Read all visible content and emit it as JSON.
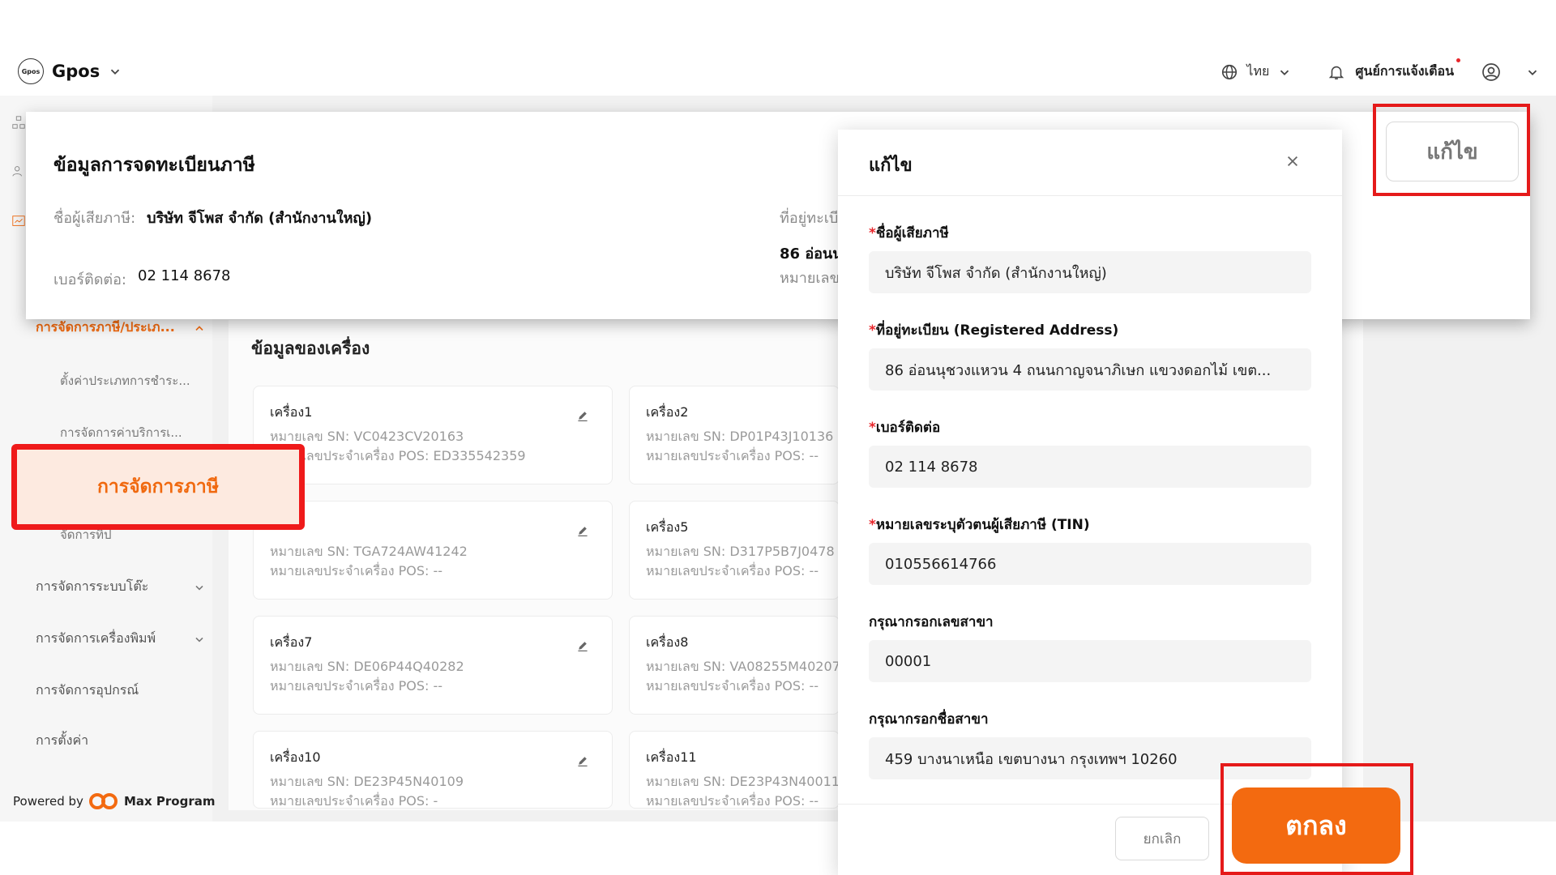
{
  "app": {
    "brand_name": "Gpos",
    "logo_text": "Gpos"
  },
  "topbar": {
    "language": "ไทย",
    "notification_center": "ศูนย์การแจ้งเตือน"
  },
  "sidebar": {
    "tax_group_label": "การจัดการภาษี/ประเภ...",
    "sub_items": [
      "ตั้งค่าประเภทการชำระ...",
      "การจัดการค่าบริการเ...",
      "จัดการทิป"
    ],
    "groups": [
      "การจัดการระบบโต๊ะ",
      "การจัดการเครื่องพิมพ์",
      "การจัดการอุปกรณ์",
      "การตั้งค่า"
    ],
    "highlighted_item": "การจัดการภาษี",
    "powered_by": "Powered by",
    "powered_brand": "Max Program"
  },
  "registration": {
    "title": "ข้อมูลการจดทะเบียนภาษี",
    "taxpayer_label": "ชื่อผู้เสียภาษี:",
    "taxpayer_value": "บริษัท จีโพส จำกัด (สำนักงานใหญ่)",
    "phone_label": "เบอร์ติดต่อ:",
    "phone_value": "02 114 8678",
    "address_label": "ที่อยู่ทะเบี",
    "address_value": "86 อ่อนนุ",
    "tin_label": "หมายเลข",
    "edit_button": "แก้ไข"
  },
  "devices": {
    "section_title": "ข้อมูลของเครื่อง",
    "cards": [
      {
        "name": "เครื่อง1",
        "sn": "หมายเลข SN:  VC0423CV20163",
        "pos": "หมายเลขประจำเครื่อง POS:  ED335542359"
      },
      {
        "name": "เครื่อง2",
        "sn": "หมายเลข SN:  DP01P43J10136",
        "pos": "หมายเลขประจำเครื่อง POS:  --"
      },
      {
        "name": "",
        "sn": "หมายเลข SN:  TGA724AW41242",
        "pos": "หมายเลขประจำเครื่อง POS:  --"
      },
      {
        "name": "เครื่อง5",
        "sn": "หมายเลข SN:  D317P5B7J0478",
        "pos": "หมายเลขประจำเครื่อง POS:  --"
      },
      {
        "name": "เครื่อง7",
        "sn": "หมายเลข SN:  DE06P44Q40282",
        "pos": "หมายเลขประจำเครื่อง POS:  --"
      },
      {
        "name": "เครื่อง8",
        "sn": "หมายเลข SN:  VA08255M40207",
        "pos": "หมายเลขประจำเครื่อง POS:  --"
      },
      {
        "name": "เครื่อง10",
        "sn": "หมายเลข SN:  DE23P45N40109",
        "pos": "หมายเลขประจำเครื่อง POS:  -"
      },
      {
        "name": "เครื่อง11",
        "sn": "หมายเลข SN:  DE23P43N40011",
        "pos": "หมายเลขประจำเครื่อง POS:  --"
      }
    ]
  },
  "modal": {
    "title": "แก้ไข",
    "fields": [
      {
        "label": "ชื่อผู้เสียภาษี",
        "required": "*",
        "value": "บริษัท จีโพส จำกัด (สำนักงานใหญ่)"
      },
      {
        "label": "ที่อยู่ทะเบียน (Registered Address)",
        "required": "*",
        "value": "86 อ่อนนุชวงแหวน  4 ถนนกาญจนาภิเษก แขวงดอกไม้ เขต..."
      },
      {
        "label": "เบอร์ติดต่อ",
        "required": "*",
        "value": "02 114 8678"
      },
      {
        "label": "หมายเลขระบุตัวตนผู้เสียภาษี (TIN)",
        "required": "*",
        "value": "010556614766"
      },
      {
        "label": "กรุณากรอกเลขสาขา",
        "required": "",
        "value": "00001"
      },
      {
        "label": "กรุณากรอกชื่อสาขา",
        "required": "",
        "value": "459 บางนาเหนือ  เขตบางนา กรุงเทพฯ 10260"
      }
    ],
    "cancel_button": "ยกเลิก",
    "ok_button": "ตกลง"
  },
  "colors": {
    "accent": "#f36a10",
    "highlight_border": "#e51a1a",
    "required": "#e8262b"
  }
}
